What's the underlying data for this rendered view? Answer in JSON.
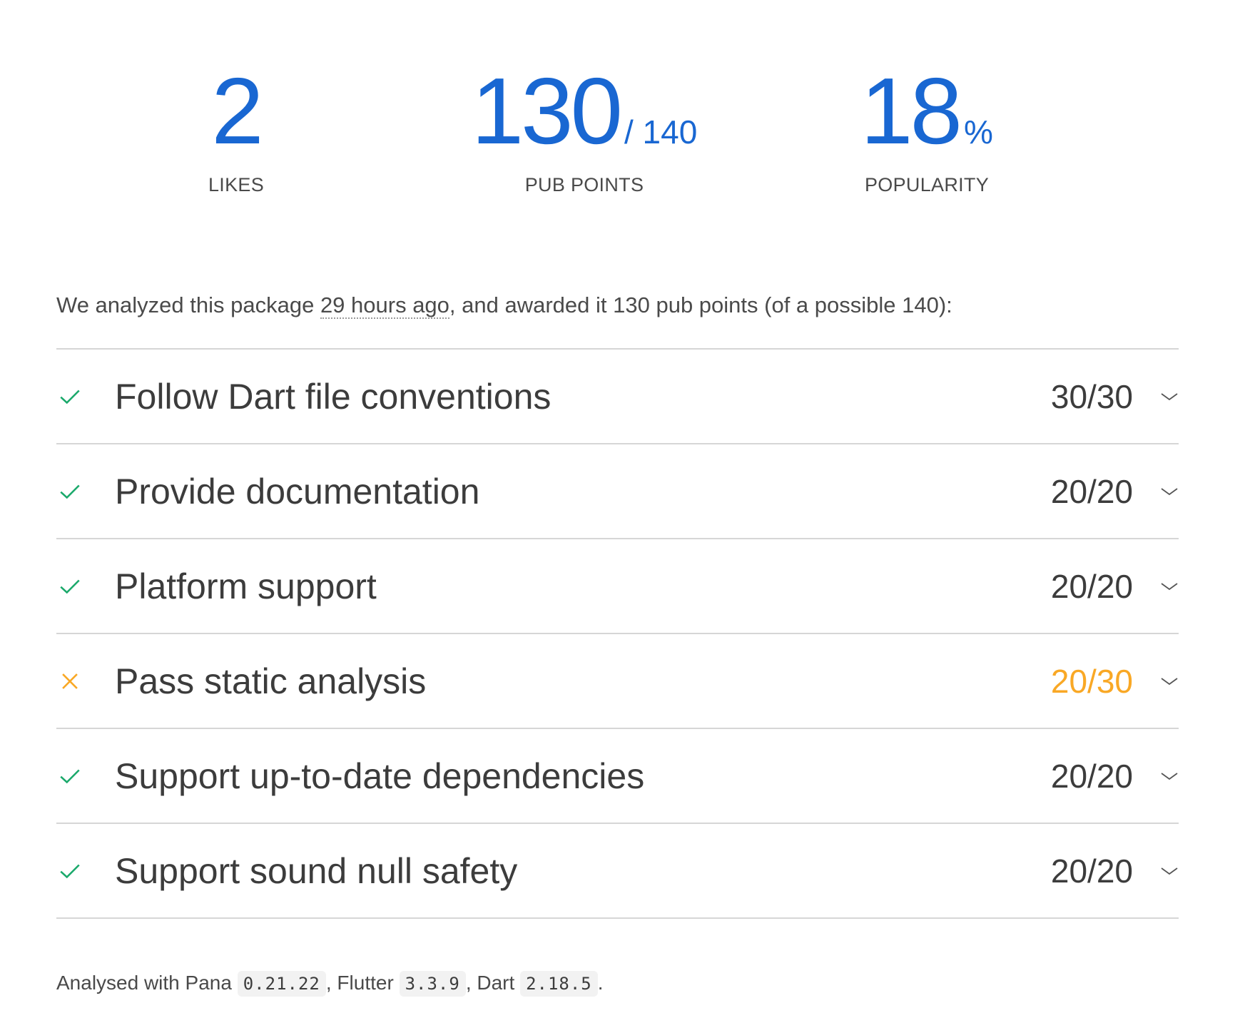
{
  "scores": {
    "likes": {
      "value": "2",
      "label": "LIKES"
    },
    "points": {
      "value": "130",
      "suffix": "/ 140",
      "label": "PUB POINTS"
    },
    "popularity": {
      "value": "18",
      "suffix": "%",
      "label": "POPULARITY"
    }
  },
  "summary": {
    "prefix": "We analyzed this package ",
    "time_ago": "29 hours ago",
    "suffix": ", and awarded it 130 pub points (of a possible 140):"
  },
  "sections": [
    {
      "title": "Follow Dart file conventions",
      "score": "30/30",
      "status": "passed"
    },
    {
      "title": "Provide documentation",
      "score": "20/20",
      "status": "passed"
    },
    {
      "title": "Platform support",
      "score": "20/20",
      "status": "passed"
    },
    {
      "title": "Pass static analysis",
      "score": "20/30",
      "status": "partial"
    },
    {
      "title": "Support up-to-date dependencies",
      "score": "20/20",
      "status": "passed"
    },
    {
      "title": "Support sound null safety",
      "score": "20/20",
      "status": "passed"
    }
  ],
  "icons": {
    "passed": "check-icon",
    "partial": "cross-icon",
    "expand": "chevron-down-icon"
  },
  "colors": {
    "accent_blue": "#1967d2",
    "passed_green": "#1aa96b",
    "partial_orange": "#f9a825",
    "divider": "#d6d6d6"
  },
  "footer": {
    "prefix": "Analysed with Pana ",
    "pana_version": "0.21.22",
    "flutter_label": ", Flutter ",
    "flutter_version": "3.3.9",
    "dart_label": ", Dart ",
    "dart_version": "2.18.5",
    "end": "."
  }
}
